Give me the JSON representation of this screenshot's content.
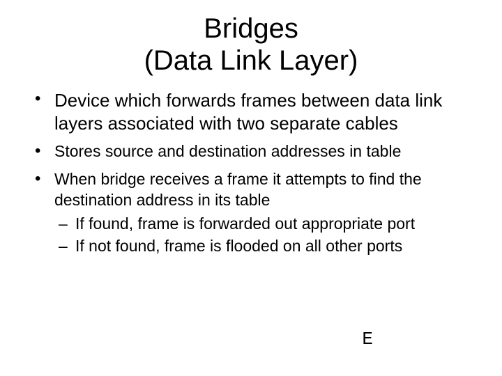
{
  "title_line1": "Bridges",
  "title_line2": "(Data Link Layer)",
  "bullets": {
    "b1": "Device which forwards frames between data link layers associated with two separate cables",
    "b2": "Stores source and destination addresses in table",
    "b3": "When bridge receives a frame it attempts to find the destination address in its table",
    "b3_sub": {
      "s1": "If found, frame is forwarded out appropriate port",
      "s2": "If not found, frame is flooded on all other ports"
    }
  },
  "footer": "E"
}
